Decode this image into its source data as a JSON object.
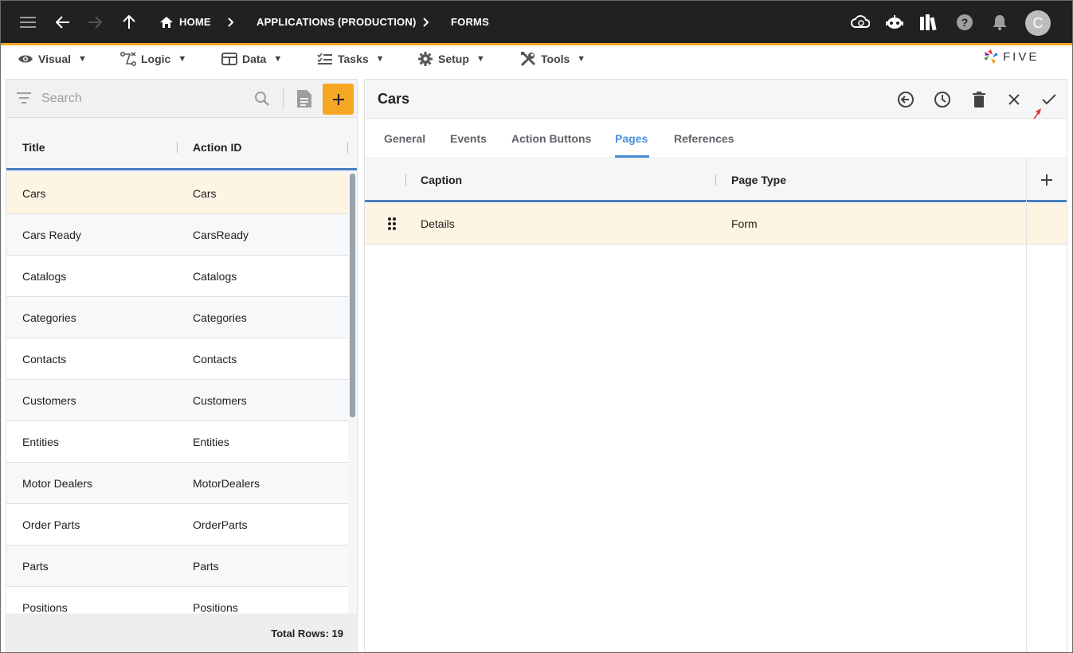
{
  "topbar": {
    "breadcrumbs": [
      "HOME",
      "APPLICATIONS (PRODUCTION)",
      "FORMS"
    ],
    "avatar_letter": "C"
  },
  "menubar": {
    "items": [
      {
        "label": "Visual",
        "icon": "eye-icon"
      },
      {
        "label": "Logic",
        "icon": "logic-icon"
      },
      {
        "label": "Data",
        "icon": "table-icon"
      },
      {
        "label": "Tasks",
        "icon": "checklist-icon"
      },
      {
        "label": "Setup",
        "icon": "gear-icon"
      },
      {
        "label": "Tools",
        "icon": "tools-icon"
      }
    ],
    "logo_text": "FIVE"
  },
  "left": {
    "search_placeholder": "Search",
    "columns": [
      "Title",
      "Action ID"
    ],
    "rows": [
      {
        "title": "Cars",
        "action_id": "Cars"
      },
      {
        "title": "Cars Ready",
        "action_id": "CarsReady"
      },
      {
        "title": "Catalogs",
        "action_id": "Catalogs"
      },
      {
        "title": "Categories",
        "action_id": "Categories"
      },
      {
        "title": "Contacts",
        "action_id": "Contacts"
      },
      {
        "title": "Customers",
        "action_id": "Customers"
      },
      {
        "title": "Entities",
        "action_id": "Entities"
      },
      {
        "title": "Motor Dealers",
        "action_id": "MotorDealers"
      },
      {
        "title": "Order Parts",
        "action_id": "OrderParts"
      },
      {
        "title": "Parts",
        "action_id": "Parts"
      },
      {
        "title": "Positions",
        "action_id": "Positions"
      }
    ],
    "footer": "Total Rows: 19"
  },
  "form": {
    "title": "Cars",
    "tabs": [
      "General",
      "Events",
      "Action Buttons",
      "Pages",
      "References"
    ],
    "active_tab": "Pages",
    "columns": [
      "Caption",
      "Page Type"
    ],
    "rows": [
      {
        "caption": "Details",
        "page_type": "Form"
      }
    ]
  },
  "colors": {
    "accent": "#f5a623",
    "active_tab": "#4a90d9",
    "topbar": "#212121",
    "selected_row": "#fdf4e3"
  }
}
